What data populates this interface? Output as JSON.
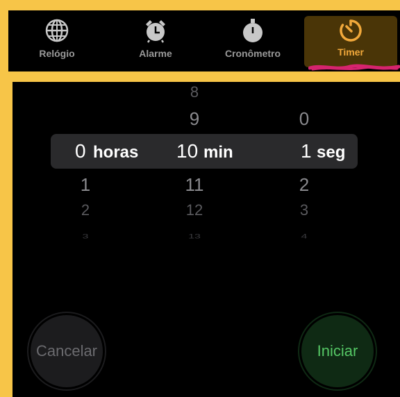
{
  "tabs": [
    {
      "label": "Relógio",
      "icon": "globe-icon"
    },
    {
      "label": "Alarme",
      "icon": "alarm-clock-icon"
    },
    {
      "label": "Cronômetro",
      "icon": "stopwatch-icon"
    },
    {
      "label": "Timer",
      "icon": "timer-icon",
      "active": true
    }
  ],
  "picker": {
    "hours": {
      "above": [
        "",
        ""
      ],
      "selected": "0",
      "unit": "horas",
      "below": [
        "1",
        "2",
        "3"
      ]
    },
    "minutes": {
      "above": [
        "8",
        "9"
      ],
      "selected": "10",
      "unit": "min",
      "below": [
        "11",
        "12",
        "13"
      ]
    },
    "seconds": {
      "above": [
        "",
        "0"
      ],
      "selected": "1",
      "unit": "seg",
      "below": [
        "2",
        "3",
        "4"
      ]
    }
  },
  "buttons": {
    "cancel": "Cancelar",
    "start": "Iniciar"
  },
  "colors": {
    "accent": "#F2A93B",
    "start_green": "#55c765",
    "frame": "#F7C548",
    "scribble": "#d6246e"
  }
}
